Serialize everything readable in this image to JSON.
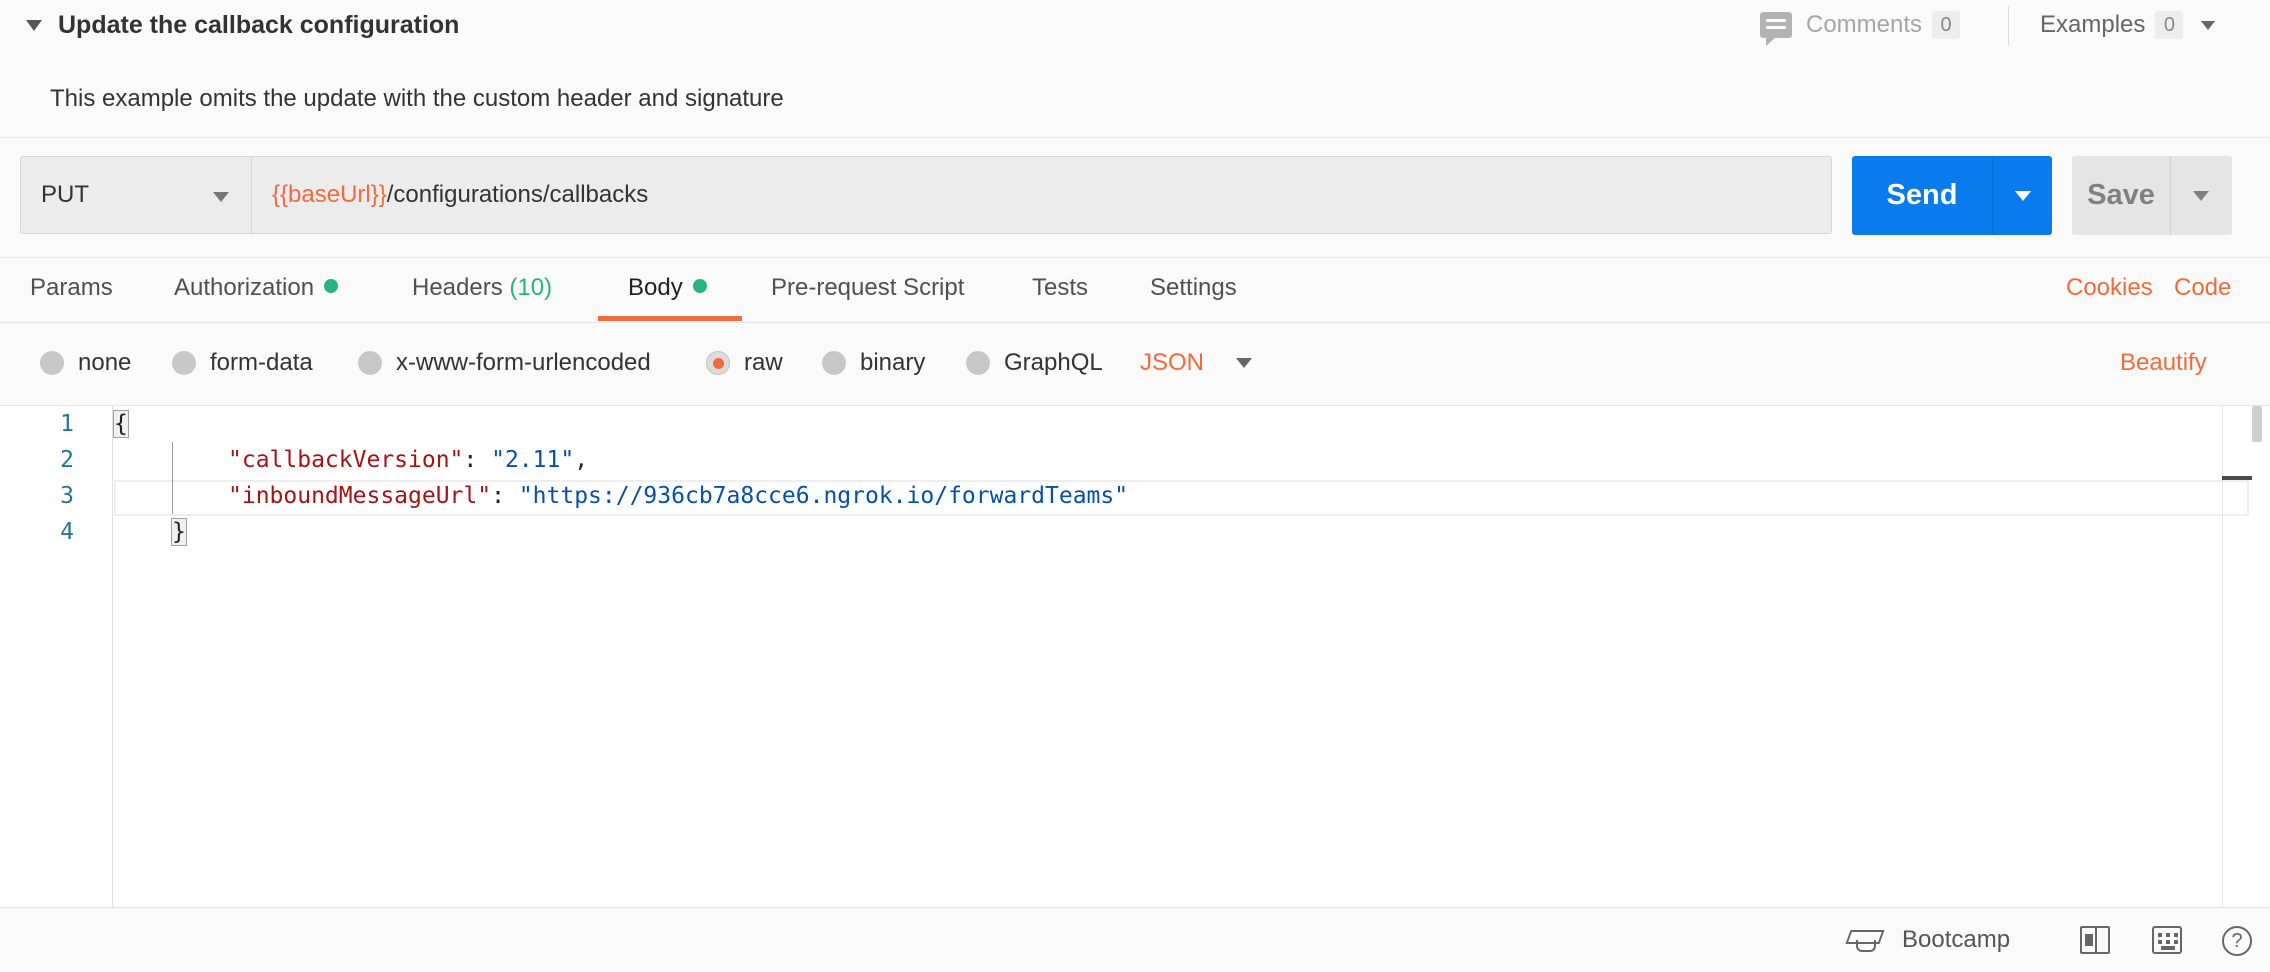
{
  "request": {
    "title": "Update the callback configuration",
    "description": "This example omits the update with the custom header and signature"
  },
  "comments": {
    "label": "Comments",
    "count": "0"
  },
  "examples": {
    "label": "Examples",
    "count": "0"
  },
  "url_bar": {
    "method": "PUT",
    "url_variable": "{{baseUrl}}",
    "url_path": "/configurations/callbacks",
    "send_label": "Send",
    "save_label": "Save"
  },
  "tabs": [
    {
      "label": "Params"
    },
    {
      "label": "Authorization"
    },
    {
      "label": "Headers",
      "count": "(10)"
    },
    {
      "label": "Body"
    },
    {
      "label": "Pre-request Script"
    },
    {
      "label": "Tests"
    },
    {
      "label": "Settings"
    }
  ],
  "tab_links": {
    "cookies": "Cookies",
    "code": "Code"
  },
  "body_types": [
    {
      "label": "none"
    },
    {
      "label": "form-data"
    },
    {
      "label": "x-www-form-urlencoded"
    },
    {
      "label": "raw"
    },
    {
      "label": "binary"
    },
    {
      "label": "GraphQL"
    }
  ],
  "selected_body_type": "raw",
  "language": "JSON",
  "beautify_label": "Beautify",
  "editor": {
    "line_numbers": [
      "1",
      "2",
      "3",
      "4"
    ],
    "open_brace": "{",
    "close_brace": "}",
    "key1": "\"callbackVersion\"",
    "value1": "\"2.11\"",
    "key2": "\"inboundMessageUrl\"",
    "value2": "\"https://936cb7a8cce6.ngrok.io/forwardTeams\""
  },
  "status_bar": {
    "bootcamp": "Bootcamp",
    "help": "?"
  },
  "colors": {
    "accent": "#f26b3a",
    "send": "#097bed",
    "indicator": "#26b47f"
  }
}
